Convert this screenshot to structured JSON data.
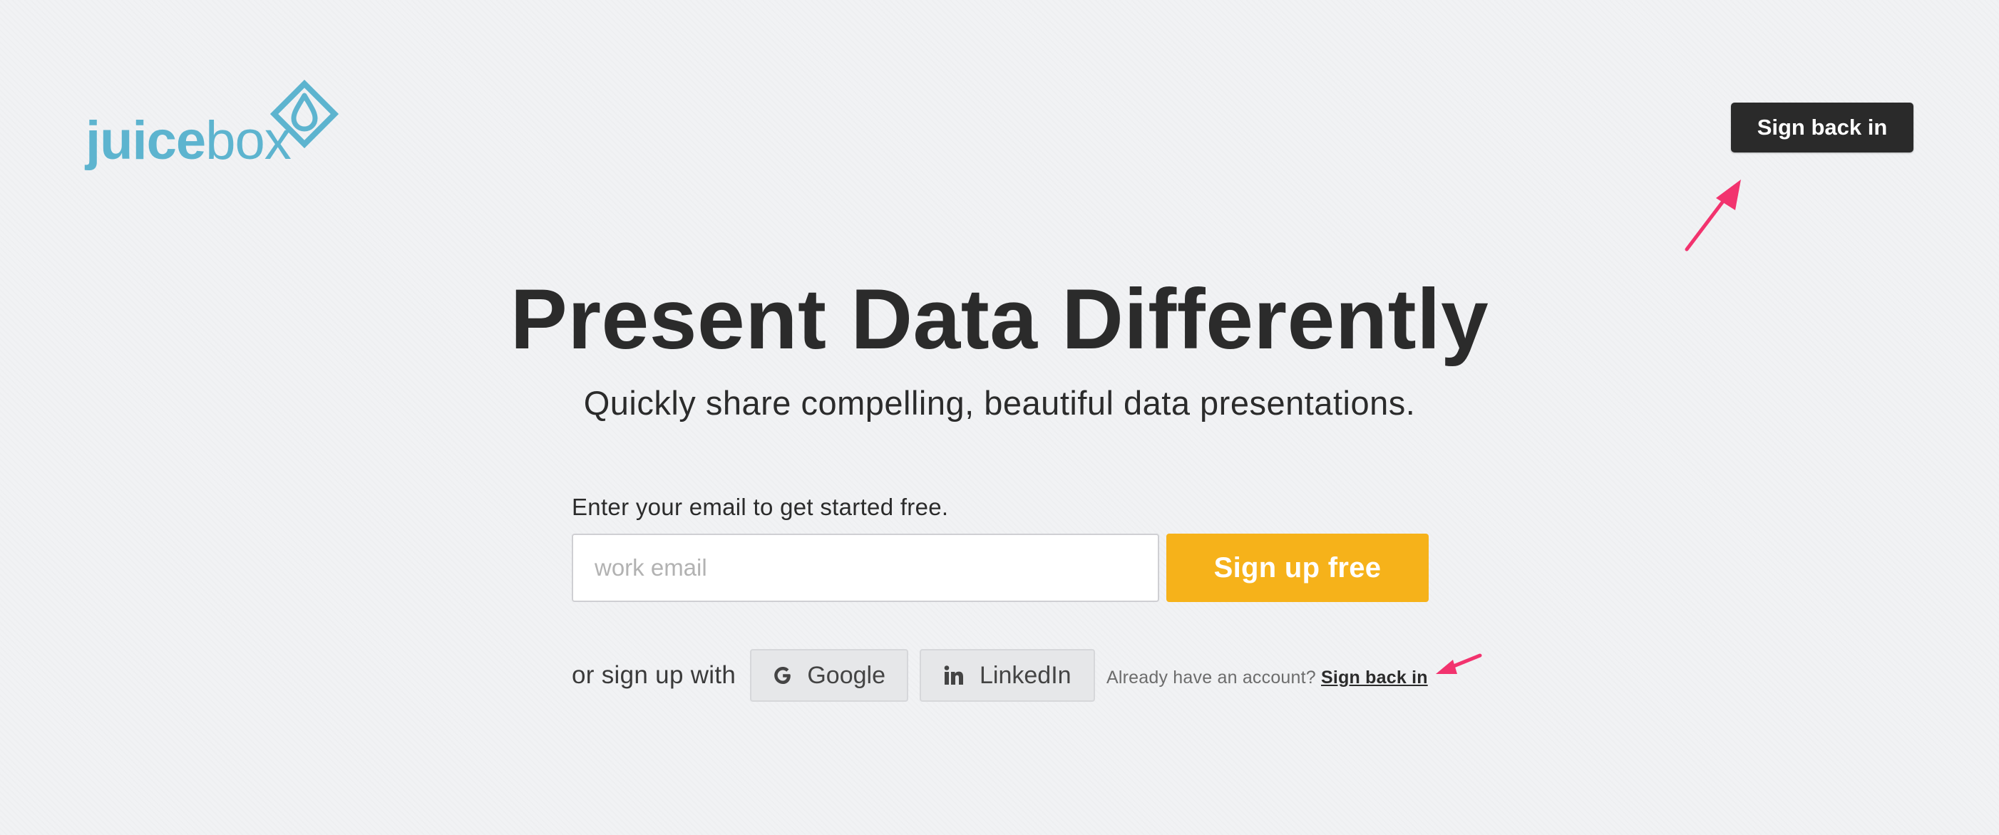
{
  "brand": {
    "name_part1": "juice",
    "name_part2": "box",
    "color": "#5db4cf"
  },
  "header": {
    "signin_label": "Sign back in"
  },
  "hero": {
    "headline": "Present Data Differently",
    "subheadline": "Quickly share compelling, beautiful data presentations."
  },
  "signup": {
    "label": "Enter your email to get started free.",
    "email_placeholder": "work email",
    "email_value": "",
    "button_label": "Sign up free"
  },
  "social": {
    "prefix": "or sign up with",
    "google_label": "Google",
    "linkedin_label": "LinkedIn",
    "google_icon": "google-icon",
    "linkedin_icon": "linkedin-icon"
  },
  "account": {
    "prompt": "Already have an account?",
    "link_label": "Sign back in"
  },
  "annotations": {
    "arrow_color": "#f2336e"
  },
  "colors": {
    "background": "#f1f2f4",
    "primary_dark": "#2a2a2a",
    "accent_yellow": "#f6b21a",
    "text": "#2b2b2b"
  }
}
